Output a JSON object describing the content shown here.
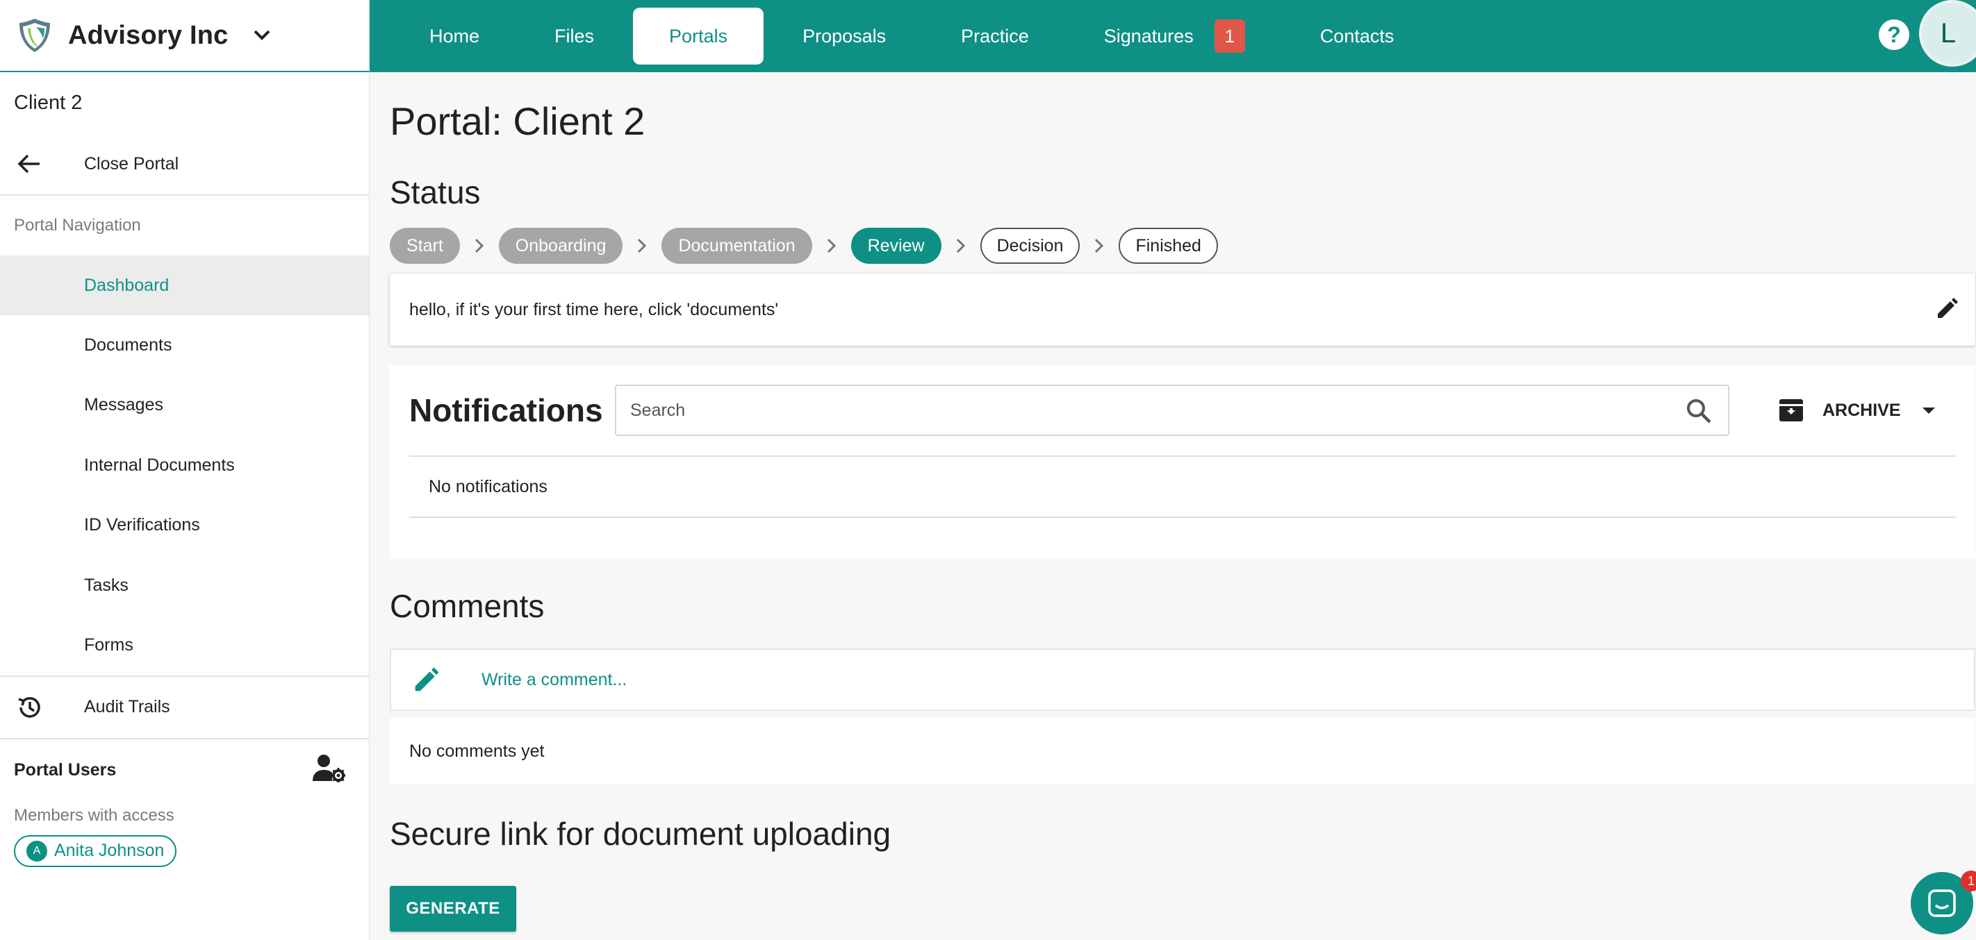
{
  "brand": {
    "name": "Advisory Inc",
    "icon": "shield-logo-icon"
  },
  "nav": {
    "items": [
      {
        "label": "Home"
      },
      {
        "label": "Files"
      },
      {
        "label": "Portals"
      },
      {
        "label": "Proposals"
      },
      {
        "label": "Practice"
      },
      {
        "label": "Signatures",
        "badge": "1"
      },
      {
        "label": "Contacts"
      }
    ],
    "active": "Portals",
    "help_icon": "help-icon",
    "user_initial": "L"
  },
  "sidebar": {
    "client": "Client 2",
    "close_portal": "Close Portal",
    "section_label": "Portal Navigation",
    "nav_items": [
      {
        "label": "Dashboard"
      },
      {
        "label": "Documents"
      },
      {
        "label": "Messages"
      },
      {
        "label": "Internal Documents"
      },
      {
        "label": "ID Verifications"
      },
      {
        "label": "Tasks"
      },
      {
        "label": "Forms"
      }
    ],
    "audit_trails": "Audit Trails",
    "portal_users": "Portal Users",
    "members_label": "Members with access",
    "member": {
      "initial": "A",
      "name": "Anita Johnson"
    }
  },
  "main": {
    "title": "Portal: Client 2",
    "status_heading": "Status",
    "steps": [
      {
        "label": "Start"
      },
      {
        "label": "Onboarding"
      },
      {
        "label": "Documentation"
      },
      {
        "label": "Review"
      },
      {
        "label": "Decision"
      },
      {
        "label": "Finished"
      }
    ],
    "note": "hello, if it's your first time here, click 'documents'",
    "notifications": {
      "title": "Notifications",
      "search_placeholder": "Search",
      "archive_label": "ARCHIVE",
      "empty": "No notifications"
    },
    "comments": {
      "title": "Comments",
      "placeholder": "Write a comment...",
      "empty": "No comments yet"
    },
    "secure_link": {
      "title": "Secure link for document uploading",
      "button": "GENERATE"
    },
    "chat_badge": "1"
  },
  "colors": {
    "accent": "#0f9085",
    "badge": "#e0574a",
    "step_done": "#a6a6a6"
  }
}
